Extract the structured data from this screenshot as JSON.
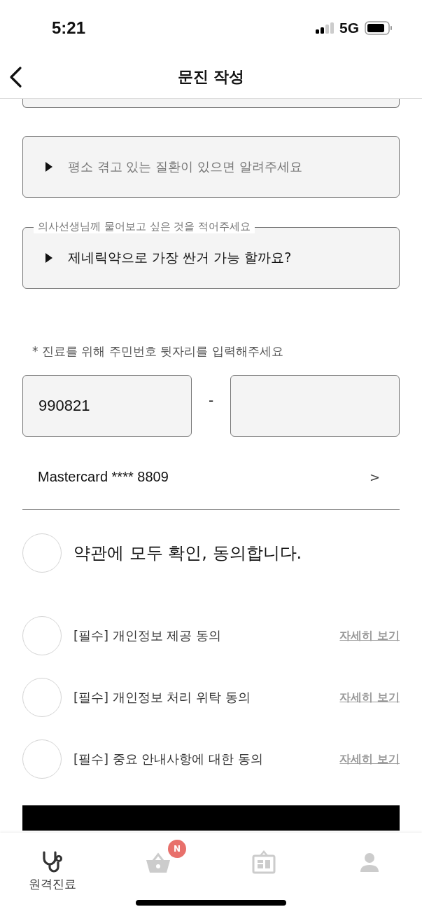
{
  "status_bar": {
    "time": "5:21",
    "network": "5G"
  },
  "header": {
    "title": "문진 작성"
  },
  "questions": [
    {
      "placeholder": "평소 겪고 있는 질환이 있으면 알려주세요"
    },
    {
      "label": "의사선생님께 물어보고 싶은 것을 적어주세요",
      "value": "제네릭약으로 가장 싼거 가능 할까요?"
    }
  ],
  "id_number": {
    "note": "* 진료를 위해 주민번호 뒷자리를 입력해주세요",
    "front": "990821",
    "separator": "-"
  },
  "payment": {
    "card": "Mastercard **** 8809",
    "chevron": ">"
  },
  "agree_all": {
    "label": "약관에 모두 확인, 동의합니다.",
    "checked": false
  },
  "terms": [
    {
      "label": "[필수] 개인정보 제공 동의",
      "link": "자세히 보기",
      "checked": false
    },
    {
      "label": "[필수] 개인정보 처리 위탁 동의",
      "link": "자세히 보기",
      "checked": false
    },
    {
      "label": "[필수] 중요 안내사항에 대한 동의",
      "link": "자세히 보기",
      "checked": false
    }
  ],
  "submit": {
    "kind": "button"
  },
  "tab_bar": [
    {
      "kind": "stethoscope",
      "label": "원격진료",
      "selected": true
    },
    {
      "kind": "basket",
      "badge": "N",
      "selected": false
    },
    {
      "kind": "board",
      "selected": false
    },
    {
      "kind": "person",
      "selected": false
    }
  ]
}
